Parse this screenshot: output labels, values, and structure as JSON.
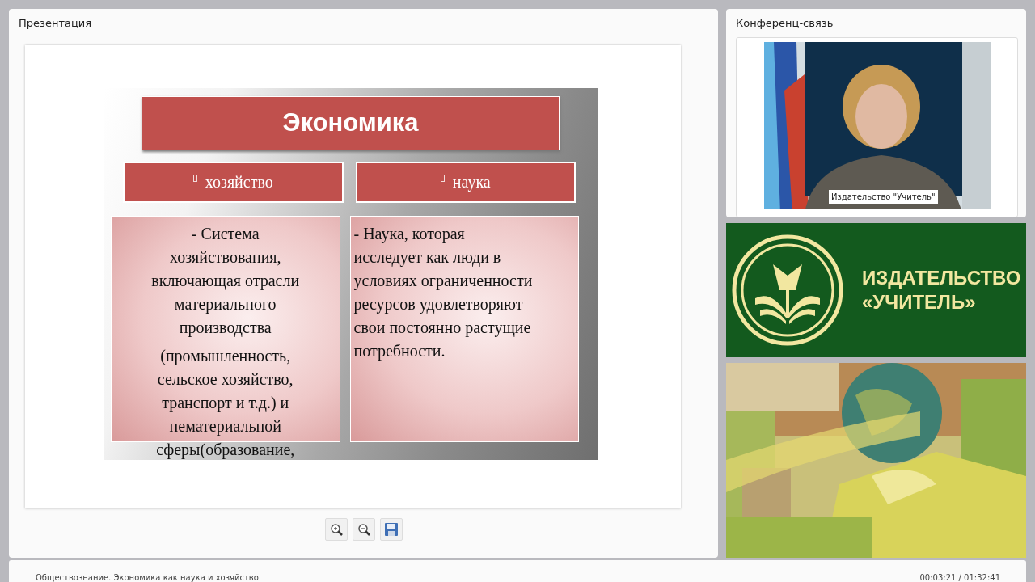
{
  "presentation": {
    "title": "Презентация",
    "slide": {
      "title": "Экономика",
      "columns": [
        {
          "heading": "хозяйство",
          "kind": "centered",
          "paragraphs": [
            [
              "- Система",
              "хозяйствования,",
              "включающая отрасли",
              "материального",
              "производства"
            ],
            [
              "(промышленность,",
              "сельское хозяйство,",
              "транспорт и т.д.) и",
              "нематериальной",
              "сферы(образование,"
            ]
          ]
        },
        {
          "heading": "наука",
          "kind": "flush",
          "paragraphs": [
            [
              "- Наука, которая",
              "исследует как люди в",
              "условиях ограниченности",
              "ресурсов удовлетворяют",
              "свои постоянно растущие",
              "потребности."
            ]
          ]
        }
      ]
    },
    "toolbar": [
      {
        "kind": "zoom-in"
      },
      {
        "kind": "zoom-out"
      },
      {
        "kind": "save"
      }
    ]
  },
  "conference": {
    "title": "Конференц-связь",
    "video": {
      "kind": "picture",
      "caption": "Издательство \"Учитель\""
    }
  },
  "banner": {
    "lines": [
      "ИЗДАТЕЛЬСТВО",
      "«УЧИТЕЛЬ»"
    ]
  },
  "status_bar": {
    "lecture": "Обществознание. Экономика как наука и хозяйство",
    "time": "00:03:21 / 01:32:41"
  }
}
